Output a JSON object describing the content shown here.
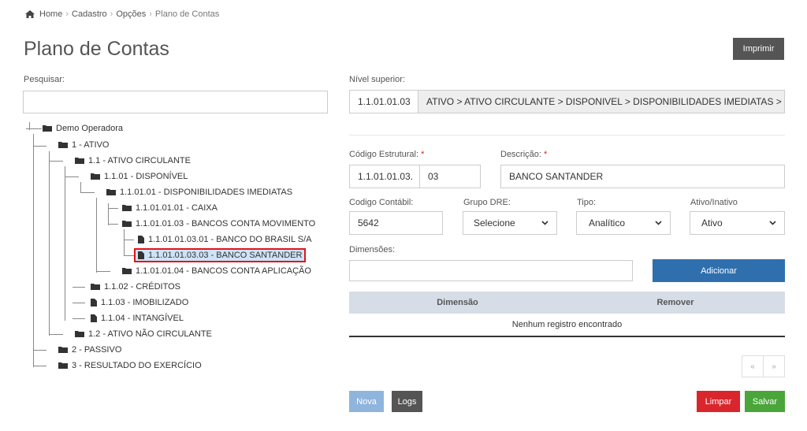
{
  "breadcrumb": {
    "items": [
      "Home",
      "Cadastro",
      "Opções"
    ],
    "current": "Plano de Contas"
  },
  "page": {
    "title": "Plano de Contas",
    "print_label": "Imprimir"
  },
  "search": {
    "label": "Pesquisar:",
    "value": "",
    "placeholder": ""
  },
  "tree": {
    "nodes": [
      {
        "label": "Demo Operadora",
        "icon": "folder"
      },
      {
        "label": "1 - ATIVO",
        "icon": "folder"
      },
      {
        "label": "1.1 - ATIVO CIRCULANTE",
        "icon": "folder"
      },
      {
        "label": "1.1.01 - DISPONÍVEL",
        "icon": "folder"
      },
      {
        "label": "1.1.01.01 - DISPONIBILIDADES IMEDIATAS",
        "icon": "folder"
      },
      {
        "label": "1.1.01.01.01 - CAIXA",
        "icon": "folder"
      },
      {
        "label": "1.1.01.01.03 - BANCOS CONTA MOVIMENTO",
        "icon": "folder"
      },
      {
        "label": "1.1.01.01.03.01 - BANCO DO BRASIL S/A",
        "icon": "file"
      },
      {
        "label": "1.1.01.01.03.03 - BANCO SANTANDER",
        "icon": "file",
        "selected": true
      },
      {
        "label": "1.1.01.01.04 - BANCOS CONTA APLICAÇÃO",
        "icon": "folder"
      },
      {
        "label": "1.1.02 - CRÉDITOS",
        "icon": "folder"
      },
      {
        "label": "1.1.03 - IMOBILIZADO",
        "icon": "file"
      },
      {
        "label": "1.1.04 - INTANGÍVEL",
        "icon": "file"
      },
      {
        "label": "1.2 - ATIVO NÃO CIRCULANTE",
        "icon": "folder"
      },
      {
        "label": "2 - PASSIVO",
        "icon": "folder"
      },
      {
        "label": "3 - RESULTADO DO EXERCÍCIO",
        "icon": "folder"
      }
    ]
  },
  "form": {
    "nivel_superior": {
      "label": "Nível superior:",
      "code": "1.1.01.01.03",
      "path": "ATIVO > ATIVO CIRCULANTE > DISPONIVEL > DISPONIBILIDADES IMEDIATAS > BANCOS CONTA MOVIMENTO"
    },
    "codigo_estrutural": {
      "label": "Código Estrutural:",
      "required_mark": "*",
      "prefix": "1.1.01.01.03.",
      "value": "03"
    },
    "descricao": {
      "label": "Descrição:",
      "required_mark": "*",
      "value": "BANCO SANTANDER"
    },
    "codigo_contabil": {
      "label": "Codigo Contábil:",
      "value": "5642"
    },
    "grupo_dre": {
      "label": "Grupo DRE:",
      "value": "Selecione"
    },
    "tipo": {
      "label": "Tipo:",
      "value": "Analítico"
    },
    "ativo_inativo": {
      "label": "Ativo/Inativo",
      "value": "Ativo"
    },
    "dimensoes": {
      "label": "Dimensões:",
      "value": "",
      "add_label": "Adicionar"
    }
  },
  "table": {
    "columns": [
      "Dimensão",
      "Remover"
    ],
    "empty_text": "Nenhum registro encontrado"
  },
  "pagination": {
    "prev": "«",
    "next": "»"
  },
  "actions": {
    "nova": "Nova",
    "logs": "Logs",
    "limpar": "Limpar",
    "salvar": "Salvar"
  },
  "colors": {
    "primary": "#2f6fad",
    "nova": "#8fb5dc",
    "dark": "#555555",
    "danger": "#d9262d",
    "success": "#4aa63a",
    "selected_border": "#e3131b",
    "table_header": "#d7dde6"
  }
}
